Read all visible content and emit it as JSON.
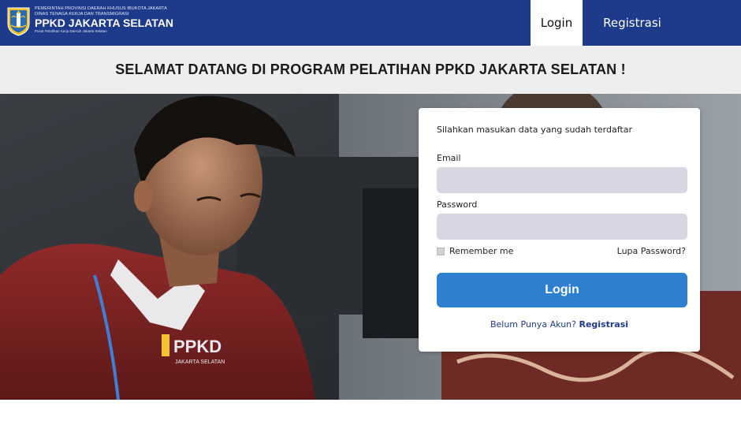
{
  "header": {
    "logo": {
      "line1": "PEMERINTAH PROVINSI DAERAH KHUSUS IBUKOTA JAKARTA",
      "line2": "DINAS TENAGA KERJA DAN TRANSMIGRASI",
      "title": "PPKD JAKARTA SELATAN",
      "tagline": "Pusat Pelatihan Kerja Daerah Jakarta Selatan",
      "crest_icon": "dki-jakarta-crest-icon"
    },
    "nav": {
      "login_label": "Login",
      "register_label": "Registrasi"
    },
    "colors": {
      "bar": "#1e3a8a",
      "active_tab": "#ffffff"
    }
  },
  "banner": {
    "text": "SELAMAT DATANG DI PROGRAM PELATIHAN PPKD JAKARTA SELATAN !"
  },
  "hero": {
    "image": "photo-trainee-at-computer",
    "shirt_logo_text": "PPKD",
    "shirt_logo_sub": "JAKARTA SELATAN"
  },
  "login_form": {
    "intro": "Silahkan masukan data yang sudah terdaftar",
    "email_label": "Email",
    "email_value": "",
    "password_label": "Password",
    "password_value": "",
    "remember_label": "Remember me",
    "remember_checked": false,
    "forgot_label": "Lupa Password?",
    "submit_label": "Login",
    "signup_prompt": "Belum Punya Akun?",
    "signup_link": "Registrasi",
    "colors": {
      "button": "#2f7fd0",
      "input_bg": "#d6d7e2",
      "link": "#1e3a8a"
    }
  }
}
